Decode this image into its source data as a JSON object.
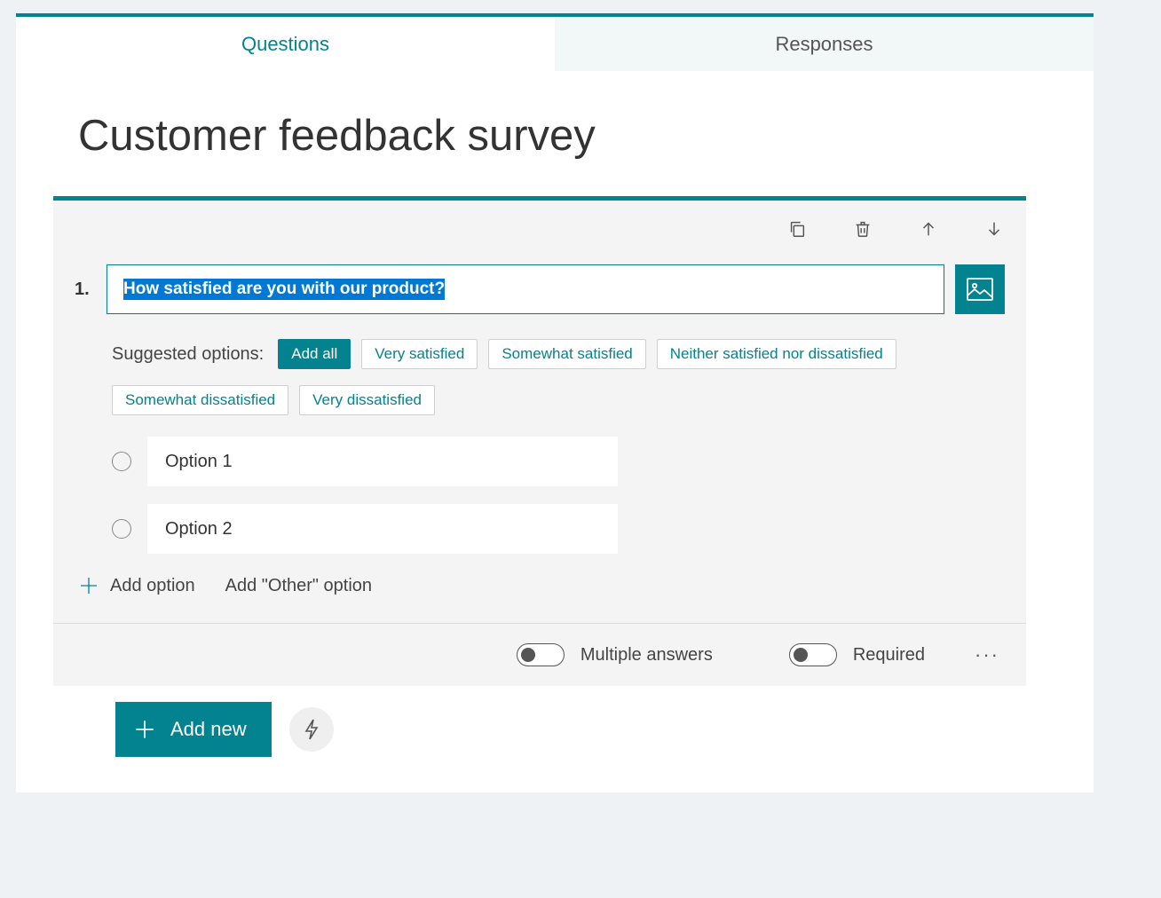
{
  "tabs": {
    "questions": "Questions",
    "responses": "Responses"
  },
  "form_title": "Customer feedback survey",
  "question": {
    "number": "1.",
    "text": "How satisfied are you with our product?"
  },
  "suggested": {
    "label": "Suggested options:",
    "add_all": "Add all",
    "items": [
      "Very satisfied",
      "Somewhat satisfied",
      "Neither satisfied nor dissatisfied",
      "Somewhat dissatisfied",
      "Very dissatisfied"
    ]
  },
  "options": [
    "Option 1",
    "Option 2"
  ],
  "add_option_label": "Add option",
  "add_other_label": "Add \"Other\" option",
  "toggles": {
    "multiple": "Multiple answers",
    "required": "Required"
  },
  "add_new_label": "Add new"
}
